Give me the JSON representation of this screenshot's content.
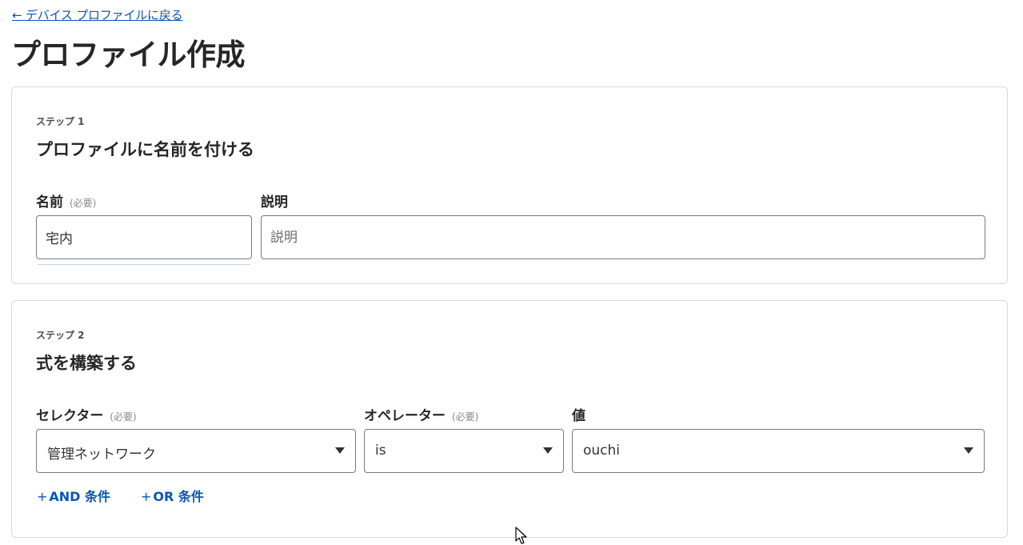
{
  "back_link": {
    "label": "← デバイス プロファイルに戻る"
  },
  "page_title": "プロファイル作成",
  "step1": {
    "step_label": "ステップ 1",
    "title": "プロファイルに名前を付ける",
    "name_field": {
      "label": "名前",
      "required_text": "(必要)",
      "value": "宅内"
    },
    "description_field": {
      "label": "説明",
      "placeholder": "説明",
      "value": ""
    }
  },
  "step2": {
    "step_label": "ステップ 2",
    "title": "式を構築する",
    "selector": {
      "label": "セレクター",
      "required_text": "(必要)",
      "value": "管理ネットワーク"
    },
    "operator": {
      "label": "オペレーター",
      "required_text": "(必要)",
      "value": "is"
    },
    "value_field": {
      "label": "値",
      "value": "ouchi"
    },
    "add_and": {
      "plus": "+",
      "label": "AND 条件"
    },
    "add_or": {
      "plus": "+",
      "label": "OR 条件"
    }
  },
  "colors": {
    "link": "#0a55b7",
    "border": "#7a7a7a",
    "card_border": "#d9d9d9"
  },
  "icons": {
    "dropdown": "caret-down-icon",
    "pointer": "mouse-pointer-icon"
  }
}
